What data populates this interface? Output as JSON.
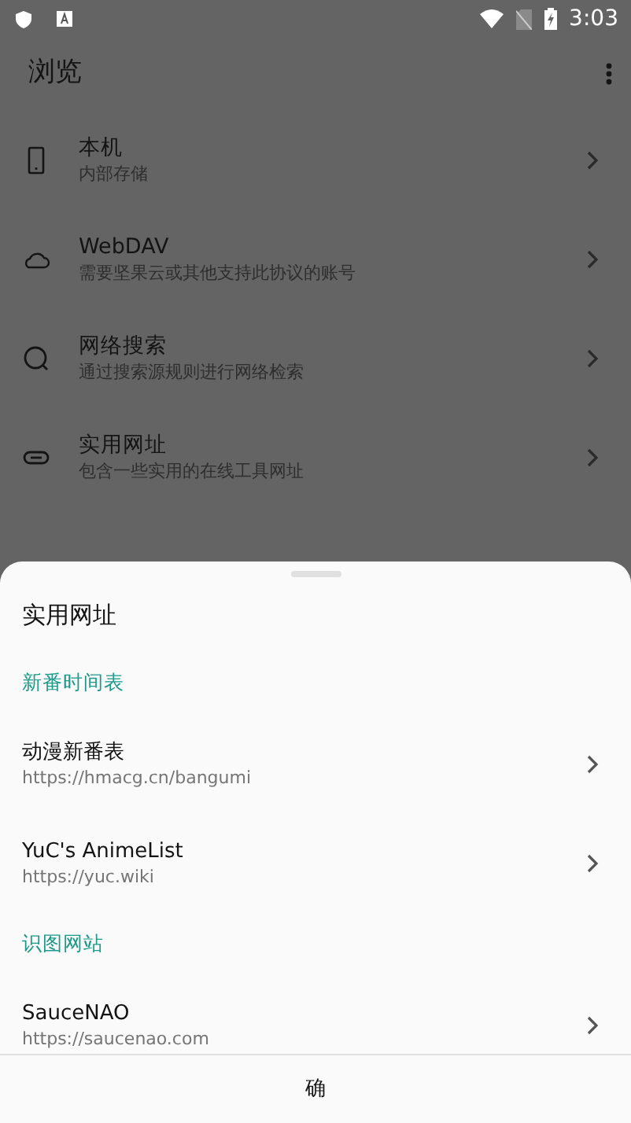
{
  "status_bar": {
    "time": "3:03"
  },
  "app_bar": {
    "title": "浏览"
  },
  "items": [
    {
      "kind": "phone",
      "title": "本机",
      "subtitle": "内部存储"
    },
    {
      "kind": "cloud",
      "title": "WebDAV",
      "subtitle": "需要坚果云或其他支持此协议的账号"
    },
    {
      "kind": "search",
      "title": "网络搜索",
      "subtitle": "通过搜索源规则进行网络检索"
    },
    {
      "kind": "link",
      "title": "实用网址",
      "subtitle": "包含一些实用的在线工具网址"
    }
  ],
  "sheet": {
    "title": "实用网址",
    "sections": [
      {
        "header": "新番时间表",
        "links": [
          {
            "title": "动漫新番表",
            "url": "https://hmacg.cn/bangumi"
          },
          {
            "title": "YuC's AnimeList",
            "url": "https://yuc.wiki"
          }
        ]
      },
      {
        "header": "识图网站",
        "links": [
          {
            "title": "SauceNAO",
            "url": "https://saucenao.com"
          }
        ]
      }
    ],
    "button": "确"
  }
}
